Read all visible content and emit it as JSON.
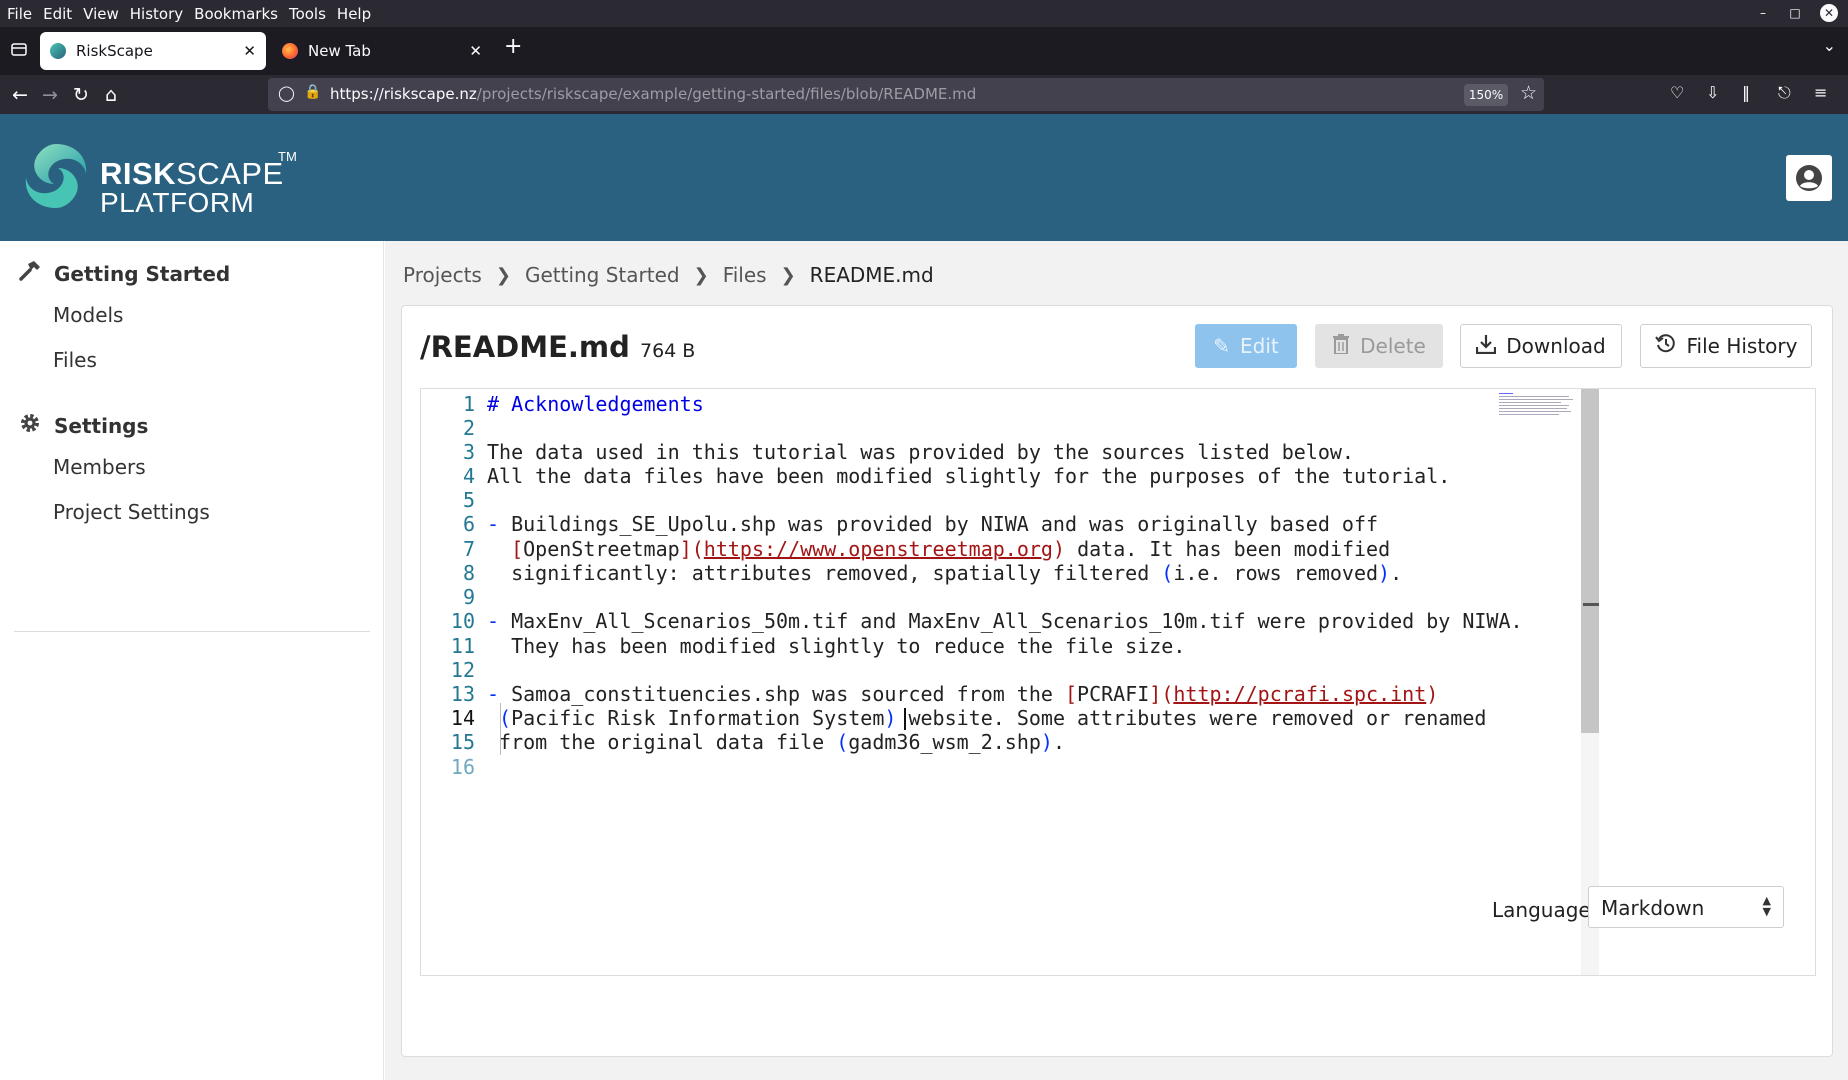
{
  "menubar": {
    "items": [
      "File",
      "Edit",
      "View",
      "History",
      "Bookmarks",
      "Tools",
      "Help"
    ]
  },
  "tabs": [
    {
      "title": "RiskScape",
      "active": true
    },
    {
      "title": "New Tab",
      "active": false
    }
  ],
  "navbar": {
    "url_host": "https://riskscape.nz",
    "url_path": "/projects/riskscape/example/getting-started/files/blob/README.md",
    "zoom": "150%"
  },
  "header": {
    "brand_line1_bold": "RISK",
    "brand_line1_rest": "SCAPE",
    "brand_line2": "PLATFORM",
    "trademark": "TM"
  },
  "sidebar": {
    "sections": [
      {
        "label": "Getting Started",
        "icon": "hammer-icon",
        "items": [
          "Models",
          "Files"
        ]
      },
      {
        "label": "Settings",
        "icon": "gear-icon",
        "items": [
          "Members",
          "Project Settings"
        ]
      }
    ]
  },
  "breadcrumb": [
    "Projects",
    "Getting Started",
    "Files",
    "README.md"
  ],
  "file": {
    "path": "/README.md",
    "size": "764 B"
  },
  "actions": {
    "edit": "Edit",
    "delete": "Delete",
    "download": "Download",
    "history": "File History"
  },
  "editor": {
    "lines": [
      "# Acknowledgements",
      "",
      "The data used in this tutorial was provided by the sources listed below.",
      "All the data files have been modified slightly for the purposes of the tutorial.",
      "",
      "- Buildings_SE_Upolu.shp was provided by NIWA and was originally based off",
      "  [OpenStreetmap](https://www.openstreetmap.org) data. It has been modified",
      "  significantly: attributes removed, spatially filtered (i.e. rows removed).",
      "",
      "- MaxEnv_All_Scenarios_50m.tif and MaxEnv_All_Scenarios_10m.tif were provided by NIWA.",
      "  They has been modified slightly to reduce the file size.",
      "",
      "- Samoa_constituencies.shp was sourced from the [PCRAFI](http://pcrafi.spc.int)",
      " (Pacific Risk Information System) website. Some attributes were removed or renamed",
      " from the original data file (gadm36_wsm_2.shp).",
      ""
    ]
  },
  "language": {
    "label": "Language",
    "selected": "Markdown"
  },
  "colors": {
    "header_bg": "#2b6180",
    "edit_btn": "#8ec3ee",
    "line_numbers": "#237893",
    "link": "#a31515",
    "heading": "#0000e6"
  }
}
